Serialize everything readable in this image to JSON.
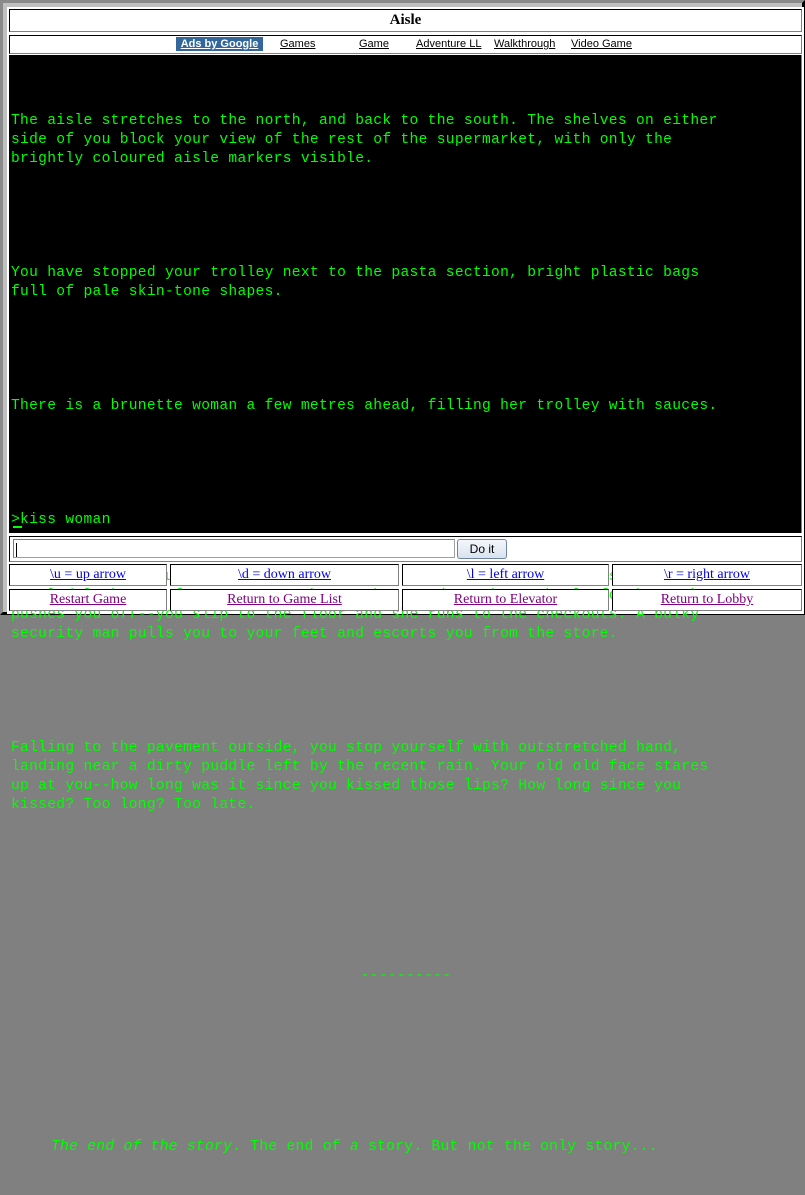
{
  "window": {
    "title": "Aisle"
  },
  "ads_bar": {
    "ads_label": "Ads by Google",
    "links": [
      "Games",
      "Game",
      "Adventure LL",
      "Walkthrough",
      "Video Game"
    ]
  },
  "game": {
    "paragraphs": [
      "The aisle stretches to the north, and back to the south. The shelves on either\nside of you block your view of the rest of the supermarket, with only the\nbrightly coloured aisle markers visible.",
      "You have stopped your trolley next to the pasta section, bright plastic bags\nfull of pale skin-tone shapes.",
      "There is a brunette woman a few metres ahead, filling her trolley with sauces."
    ],
    "command_echo": ">kiss woman",
    "response_paragraphs": [
      "You walk briskly up to the brunette. As you lean over her she turns and gives a\npuzzled look. You force your mouth onto hers and reach out hotly for her. She\npushes you off--you slip to the floor and she runs to the checkouts. A bulky\nsecurity man pulls you to your feet and escorts you from the store.",
      "Falling to the pavement outside, you stop yourself with outstretched hand,\nlanding near a dirty puddle left by the recent rain. Your old old face stares\nup at you--how long was it since you kissed those lips? How long since you\nkissed? Too long? Too late."
    ],
    "divider": "----------",
    "ending": {
      "part1_italic": "The end of the story",
      "part2": ". The end of ",
      "part3_italic": "a",
      "part4": " story. But not the only story..."
    },
    "text_color": "#00ff00",
    "background_color": "#000000"
  },
  "command": {
    "input_value": "",
    "input_placeholder": "",
    "submit_label": "Do it"
  },
  "shortcut_links": [
    {
      "label": "\\u = up arrow"
    },
    {
      "label": "\\d = down arrow"
    },
    {
      "label": "\\l = left arrow"
    },
    {
      "label": "\\r = right arrow"
    }
  ],
  "nav_links": [
    {
      "label": "Restart Game"
    },
    {
      "label": "Return to Game List"
    },
    {
      "label": "Return to Elevator"
    },
    {
      "label": "Return to Lobby"
    }
  ],
  "colors": {
    "link_unvisited": "#0000ee",
    "link_visited": "#800080",
    "ads_label_bg": "#336699"
  }
}
